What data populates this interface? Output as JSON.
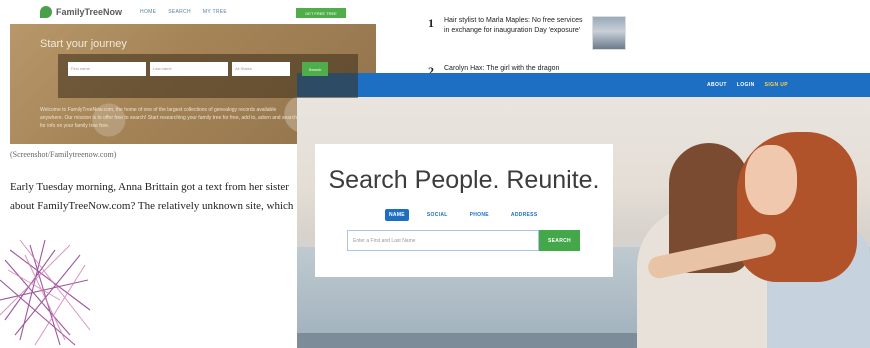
{
  "article": {
    "ftn": {
      "logo_text": "FamilyTreeNow",
      "nav_links": [
        "HOME",
        "SEARCH",
        "MY TREE"
      ],
      "cta_label": "GET FREE TREE",
      "hero_title": "Start your journey",
      "first_name_placeholder": "First name",
      "last_name_placeholder": "Last name",
      "state_value": "All States",
      "search_label": "Search",
      "welcome_text": "Welcome to FamilyTreeNow.com, the home of one of the largest collections of genealogy records available anywhere. Our mission is to offer free to search! Start researching your family tree for free, add to, adorn and search for info on your family tree free."
    },
    "caption": "(Screenshot/Familytreenow.com)",
    "body": "Early Tuesday morning, Anna Brittain got a text from her sister about FamilyTreeNow.com? The relatively unknown site, which",
    "sidebar": {
      "items": [
        {
          "num": "1",
          "text": "Hair stylist to Marla Maples: No free services in exchange for inauguration Day 'exposure'"
        },
        {
          "num": "2",
          "text": "Carolyn Hax: The girl with the dragon"
        }
      ]
    }
  },
  "overlay": {
    "nav": [
      "ABOUT",
      "LOGIN",
      "SIGN UP"
    ],
    "heading": "Search People. Reunite.",
    "tabs": [
      "NAME",
      "SOCIAL",
      "PHONE",
      "ADDRESS"
    ],
    "search_placeholder": "Enter a First and Last Name",
    "search_button": "SEARCH"
  },
  "colors": {
    "brand_blue": "#1d6fc4",
    "search_green": "#44a84a",
    "signup_yellow": "#ffd640",
    "ftn_green": "#4fae49"
  }
}
